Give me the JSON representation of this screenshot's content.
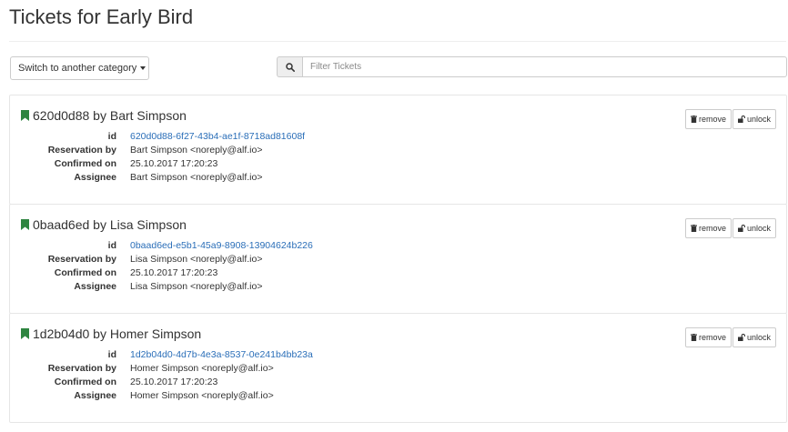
{
  "page": {
    "title": "Tickets for Early Bird"
  },
  "toolbar": {
    "category_button_label": "Switch to another category",
    "filter_placeholder": "Filter Tickets"
  },
  "labels": {
    "id": "id",
    "reservation_by": "Reservation by",
    "confirmed_on": "Confirmed on",
    "assignee": "Assignee"
  },
  "buttons": {
    "remove": "remove",
    "unlock": "unlock"
  },
  "tickets": [
    {
      "title": "620d0d88 by Bart Simpson",
      "id": "620d0d88-6f27-43b4-ae1f-8718ad81608f",
      "reservation_by": "Bart Simpson <noreply@alf.io>",
      "confirmed_on": "25.10.2017 17:20:23",
      "assignee": "Bart Simpson <noreply@alf.io>"
    },
    {
      "title": "0baad6ed by Lisa Simpson",
      "id": "0baad6ed-e5b1-45a9-8908-13904624b226",
      "reservation_by": "Lisa Simpson <noreply@alf.io>",
      "confirmed_on": "25.10.2017 17:20:23",
      "assignee": "Lisa Simpson <noreply@alf.io>"
    },
    {
      "title": "1d2b04d0 by Homer Simpson",
      "id": "1d2b04d0-4d7b-4e3a-8537-0e241b4bb23a",
      "reservation_by": "Homer Simpson <noreply@alf.io>",
      "confirmed_on": "25.10.2017 17:20:23",
      "assignee": "Homer Simpson <noreply@alf.io>"
    }
  ],
  "colors": {
    "bookmark": "#2e8540",
    "link": "#2a6eb8",
    "border": "#e6e6e6"
  },
  "icons": {
    "bookmark": "bookmark-icon",
    "search": "search-icon",
    "trash": "trash-icon",
    "unlock": "unlock-icon",
    "caret": "caret-down-icon"
  }
}
